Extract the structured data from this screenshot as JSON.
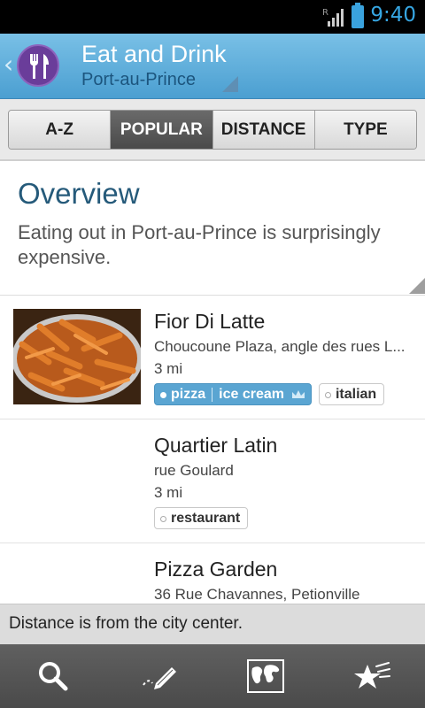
{
  "status": {
    "time": "9:40",
    "signal_label": "R",
    "accent": "#36a6e2"
  },
  "header": {
    "title": "Eat and Drink",
    "subtitle": "Port-au-Prince",
    "logo_icon": "fork-knife-icon",
    "back_icon": "chevron-left-icon"
  },
  "tabs": [
    {
      "label": "A-Z",
      "active": false
    },
    {
      "label": "POPULAR",
      "active": true
    },
    {
      "label": "DISTANCE",
      "active": false
    },
    {
      "label": "TYPE",
      "active": false
    }
  ],
  "overview": {
    "title": "Overview",
    "text": "Eating out in Port-au-Prince is surprisingly expensive."
  },
  "places": [
    {
      "name": "Fior Di Latte",
      "address": "Choucoune Plaza, angle des rues L...",
      "distance": "3 mi",
      "tags_blue": [
        "pizza",
        "ice cream"
      ],
      "tags": [
        "italian"
      ],
      "has_photo": true
    },
    {
      "name": "Quartier Latin",
      "address": "rue Goulard",
      "distance": "3 mi",
      "tags_blue": [],
      "tags": [
        "restaurant"
      ],
      "has_photo": false
    },
    {
      "name": "Pizza Garden",
      "address": "36 Rue Chavannes, Petionville",
      "distance": "",
      "tags_blue": [],
      "tags": [],
      "has_photo": false
    }
  ],
  "note": "Distance is from the city center.",
  "bottom_nav": [
    "search-icon",
    "edit-icon",
    "map-icon",
    "favorites-icon"
  ]
}
